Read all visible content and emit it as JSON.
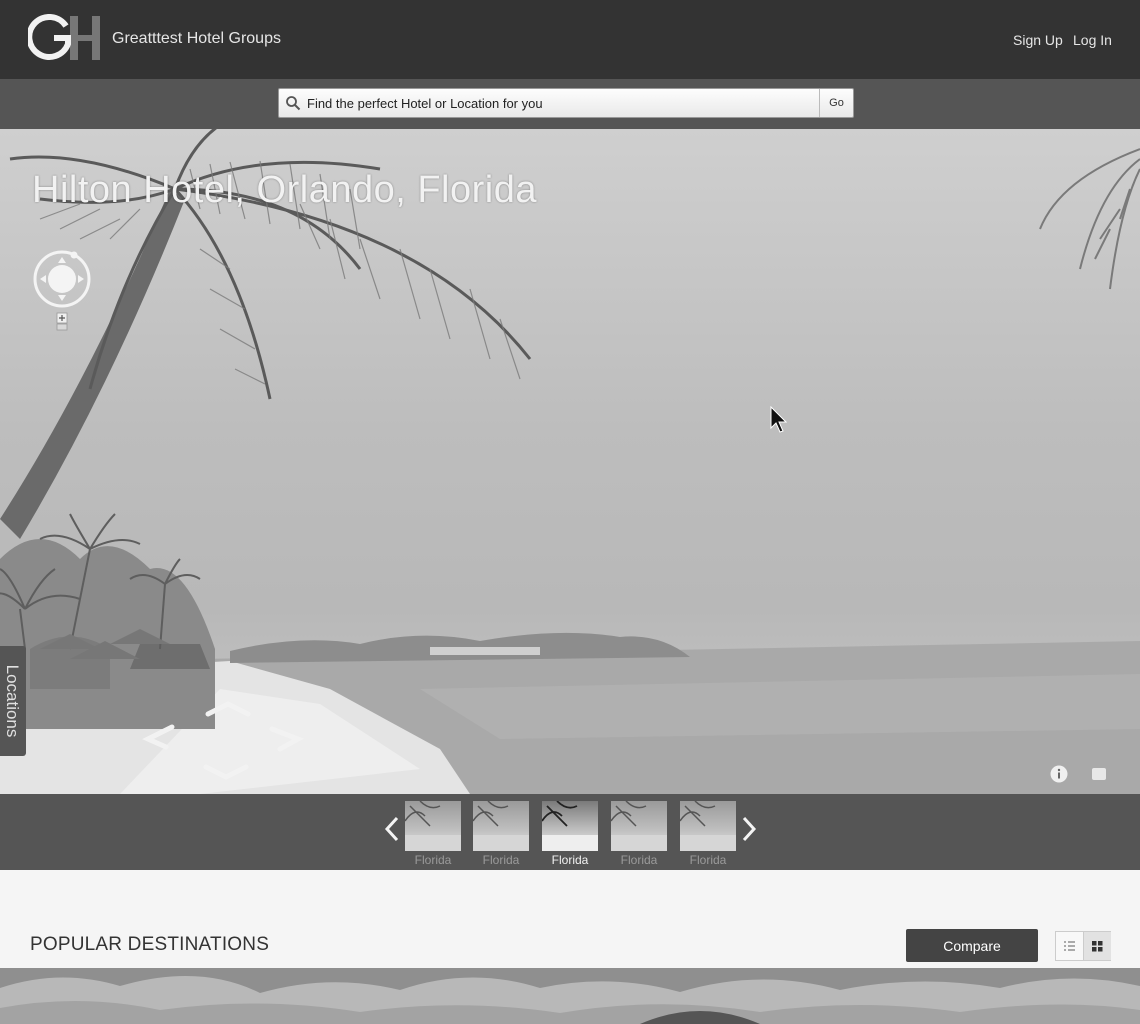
{
  "header": {
    "logo_text": "GH",
    "brand": "Greatttest Hotel Groups",
    "signup": "Sign Up",
    "login": "Log In"
  },
  "search": {
    "placeholder": "Find the perfect Hotel or Location for you",
    "go": "Go"
  },
  "hero": {
    "title": "Hilton Hotel, Orlando, Florida",
    "locations_tab": "Locations"
  },
  "thumbnails": {
    "items": [
      {
        "label": "Florida",
        "active": false
      },
      {
        "label": "Florida",
        "active": false
      },
      {
        "label": "Florida",
        "active": true
      },
      {
        "label": "Florida",
        "active": false
      },
      {
        "label": "Florida",
        "active": false
      }
    ]
  },
  "popular": {
    "title": "POPULAR DESTINATIONS",
    "compare": "Compare"
  },
  "icons": {
    "search": "search-icon",
    "compass": "compass-icon",
    "zoom": "zoom-in-icon",
    "info": "info-icon",
    "fullscreen": "fullscreen-icon",
    "list_view": "list-view-icon",
    "grid_view": "grid-view-icon",
    "prev": "chevron-left-icon",
    "next": "chevron-right-icon"
  }
}
